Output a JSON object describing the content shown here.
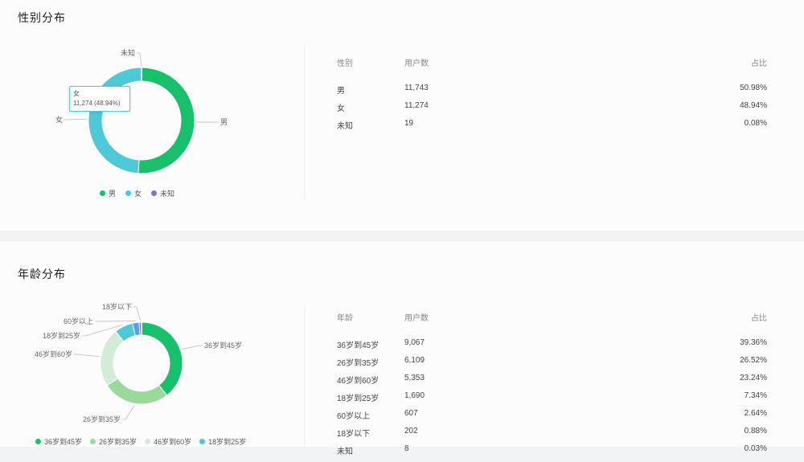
{
  "gender": {
    "title": "性别分布",
    "tooltip": {
      "label": "女",
      "value": "11,274 (48.94%)"
    },
    "table": {
      "headers": [
        "性别",
        "用户数",
        "占比"
      ],
      "rows": [
        [
          "男",
          "11,743",
          "50.98%"
        ],
        [
          "女",
          "11,274",
          "48.94%"
        ],
        [
          "未知",
          "19",
          "0.08%"
        ]
      ]
    },
    "legend": [
      "男",
      "女",
      "未知"
    ],
    "chart_data": {
      "type": "pie",
      "categories": [
        "男",
        "女",
        "未知"
      ],
      "values": [
        11743,
        11274,
        19
      ],
      "colors": [
        "#19c06b",
        "#4fc8d8",
        "#7b78b8"
      ]
    }
  },
  "age": {
    "title": "年龄分布",
    "table": {
      "headers": [
        "年龄",
        "用户数",
        "占比"
      ],
      "rows": [
        [
          "36岁到45岁",
          "9,067",
          "39.36%"
        ],
        [
          "26岁到35岁",
          "6,109",
          "26.52%"
        ],
        [
          "46岁到60岁",
          "5,353",
          "23.24%"
        ],
        [
          "18岁到25岁",
          "1,690",
          "7.34%"
        ],
        [
          "60岁以上",
          "607",
          "2.64%"
        ],
        [
          "18岁以下",
          "202",
          "0.88%"
        ],
        [
          "未知",
          "8",
          "0.03%"
        ]
      ]
    },
    "legend": [
      "36岁到45岁",
      "26岁到35岁",
      "46岁到60岁",
      "18岁到25岁"
    ],
    "chart_data": {
      "type": "pie",
      "categories": [
        "36岁到45岁",
        "26岁到35岁",
        "46岁到60岁",
        "18岁到25岁",
        "60岁以上",
        "18岁以下",
        "未知"
      ],
      "values": [
        9067,
        6109,
        5353,
        1690,
        607,
        202,
        8
      ],
      "colors": [
        "#19c06b",
        "#99d99a",
        "#d3ecd8",
        "#4fc8d8",
        "#5a9fe0",
        "#7b78b8",
        "#b5b5c8"
      ]
    }
  }
}
